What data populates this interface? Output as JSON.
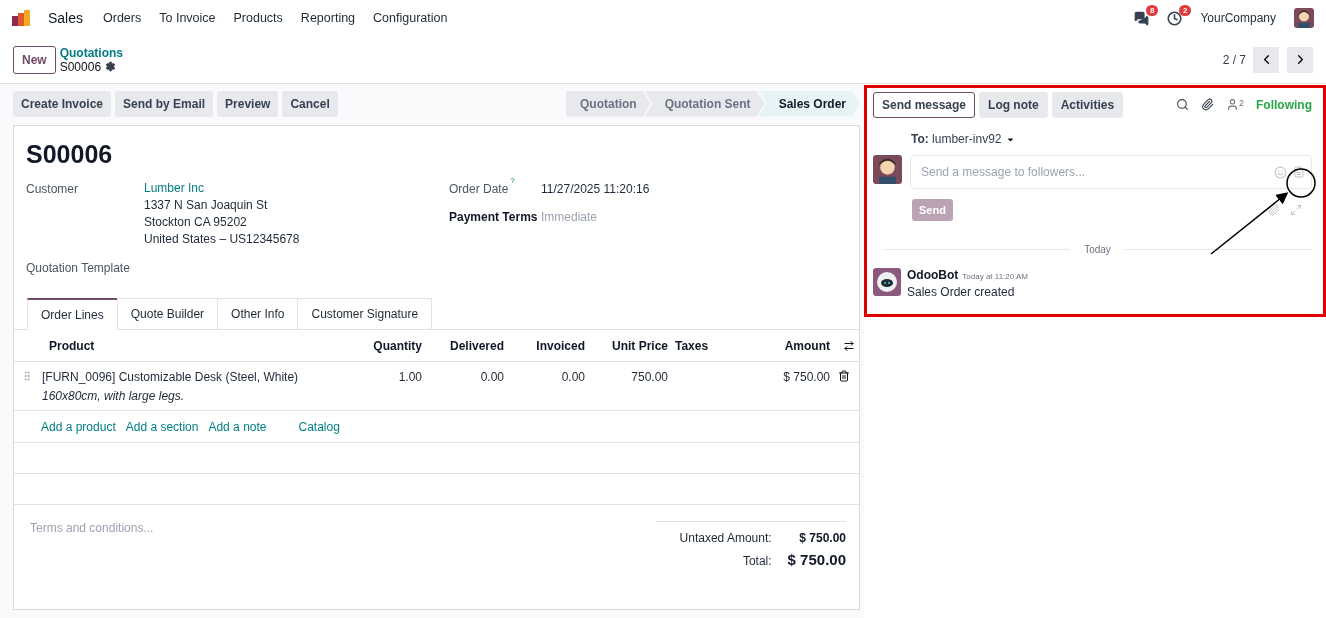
{
  "navbar": {
    "app_name": "Sales",
    "menu": [
      "Orders",
      "To Invoice",
      "Products",
      "Reporting",
      "Configuration"
    ],
    "messages_badge": "8",
    "activities_badge": "2",
    "company": "YourCompany"
  },
  "control_panel": {
    "new_button": "New",
    "breadcrumb": "Quotations",
    "record": "S00006",
    "pager": "2 / 7"
  },
  "actions": {
    "buttons": [
      "Create Invoice",
      "Send by Email",
      "Preview",
      "Cancel"
    ],
    "status_steps": [
      {
        "label": "Quotation",
        "selected": false
      },
      {
        "label": "Quotation Sent",
        "selected": false
      },
      {
        "label": "Sales Order",
        "selected": true
      }
    ]
  },
  "form": {
    "title": "S00006",
    "customer": {
      "label": "Customer",
      "name": "Lumber Inc",
      "address": [
        "1337 N San Joaquin St",
        "Stockton CA 95202",
        "United States – US12345678"
      ]
    },
    "quotation_template": {
      "label": "Quotation Template"
    },
    "order_date": {
      "label": "Order Date",
      "help": "?",
      "value": "11/27/2025 11:20:16"
    },
    "payment_terms": {
      "label": "Payment Terms",
      "placeholder": "Immediate"
    }
  },
  "tabs": [
    {
      "label": "Order Lines",
      "selected": true
    },
    {
      "label": "Quote Builder",
      "selected": false
    },
    {
      "label": "Other Info",
      "selected": false
    },
    {
      "label": "Customer Signature",
      "selected": false
    }
  ],
  "table": {
    "columns": [
      "Product",
      "Quantity",
      "Delivered",
      "Invoiced",
      "Unit Price",
      "Taxes",
      "Amount"
    ],
    "rows": [
      {
        "product": "[FURN_0096] Customizable Desk (Steel, White)",
        "description": "160x80cm, with large legs.",
        "quantity": "1.00",
        "delivered": "0.00",
        "invoiced": "0.00",
        "unit_price": "750.00",
        "amount": "$ 750.00"
      }
    ],
    "add_links": [
      "Add a product",
      "Add a section",
      "Add a note",
      "Catalog"
    ]
  },
  "terms_placeholder": "Terms and conditions...",
  "totals": [
    {
      "label": "Untaxed Amount:",
      "value": "$ 750.00",
      "kind": "subtotal"
    },
    {
      "label": "Total:",
      "value": "$ 750.00",
      "kind": "total"
    }
  ],
  "chatter": {
    "tabs": [
      {
        "label": "Send message",
        "selected": true
      },
      {
        "label": "Log note",
        "selected": false
      },
      {
        "label": "Activities",
        "selected": false
      }
    ],
    "followers_count": "2",
    "following": "Following",
    "to_label": "To:",
    "recipient": "lumber-inv92",
    "placeholder": "Send a message to followers...",
    "send_button": "Send",
    "send_disabled": true,
    "divider": "Today",
    "messages": [
      {
        "author": "OdooBot",
        "time": "Today at 11:20 AM",
        "body": "Sales Order created"
      }
    ]
  }
}
